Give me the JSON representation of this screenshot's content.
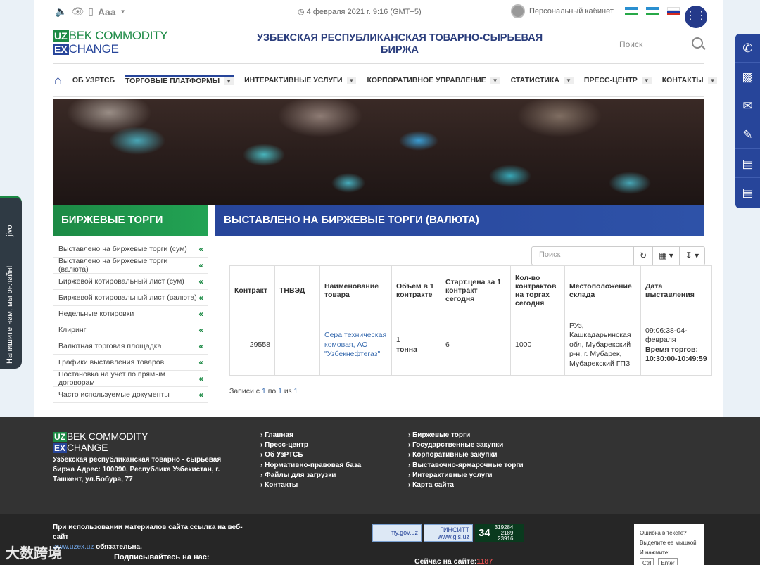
{
  "topbar": {
    "font_size_label": "Aaa",
    "datetime": "4 февраля 2021 г. 9:16 (GMT+5)",
    "cabinet_label": "Персональный кабинет"
  },
  "header": {
    "logo_box_1": "UZ",
    "logo_text_1": "BEK COMMODITY",
    "logo_box_2": "EX",
    "logo_text_2": "CHANGE",
    "title": "УЗБЕКСКАЯ РЕСПУБЛИКАНСКАЯ ТОВАРНО-СЫРЬЕВАЯ БИРЖА",
    "search_placeholder": "Поиск"
  },
  "nav": {
    "items": [
      {
        "label": "ОБ УЗРТСБ"
      },
      {
        "label": "ТОРГОВЫЕ ПЛАТФОРМЫ"
      },
      {
        "label": "ИНТЕРАКТИВНЫЕ УСЛУГИ"
      },
      {
        "label": "КОРПОРАТИВНОЕ УПРАВЛЕНИЕ"
      },
      {
        "label": "СТАТИСТИКА"
      },
      {
        "label": "ПРЕСС-ЦЕНТР"
      },
      {
        "label": "КОНТАКТЫ"
      }
    ]
  },
  "banner": {
    "left_title": "БИРЖЕВЫЕ ТОРГИ",
    "right_title": "ВЫСТАВЛЕНО НА БИРЖЕВЫЕ ТОРГИ (ВАЛЮТА)"
  },
  "sidebar": {
    "items": [
      {
        "label": "Выставлено на биржевые торги (сум)"
      },
      {
        "label": "Выставлено на биржевые торги (валюта)"
      },
      {
        "label": "Биржевой котировальный лист (сум)"
      },
      {
        "label": "Биржевой котировальный лист (валюта)"
      },
      {
        "label": "Недельные котировки"
      },
      {
        "label": "Клиринг"
      },
      {
        "label": "Валютная торговая площадка"
      },
      {
        "label": "Графики выставления товаров"
      },
      {
        "label": "Постановка на учет по прямым договорам"
      },
      {
        "label": "Часто используемые документы"
      }
    ]
  },
  "tools": {
    "search_placeholder": "Поиск"
  },
  "table": {
    "headers": [
      "Контракт",
      "ТНВЭД",
      "Наименование товара",
      "Объем в 1 контракте",
      "Старт.цена за 1 контракт сегодня",
      "Кол-во контрактов на торгах сегодня",
      "Местоположение склада",
      "Дата выставления"
    ],
    "row": {
      "contract": "29558",
      "tnved": "",
      "name": "Сера техническая комовая, АО \"Узбекнефтегаз\"",
      "volume_num": "1",
      "volume_unit": "тонна",
      "price": "6",
      "count": "1000",
      "location": "РУз, Кашкадарьинская обл, Мубарекский р-н, г. Мубарек, Мубарекский ГПЗ",
      "date": "09:06:38-04-февраля",
      "time_label": "Время торгов:",
      "time_value": "10:30:00-10:49:59"
    }
  },
  "records": {
    "prefix": "Записи с",
    "from": "1",
    "mid": "по",
    "to": "1",
    "mid2": "из",
    "total": "1"
  },
  "live_widget": {
    "label": "Напишите нам, мы онлайн!",
    "short": "jivo"
  },
  "footer": {
    "logo_box_1": "UZ",
    "logo_text_1": "BEK COMMODITY",
    "logo_box_2": "EX",
    "logo_text_2": "CHANGE",
    "address": "Узбекская республиканская товарно - сырьевая биржа Адрес: 100090, Республика Узбекистан, г. Ташкент, ул.Бобура, 77",
    "links_col1": [
      "Главная",
      "Пресс-центр",
      "Об УзРТСБ",
      "Нормативно-правовая база",
      "Файлы для загрузки",
      "Контакты"
    ],
    "links_col2": [
      "Биржевые торги",
      "Государственные закупки",
      "Корпоративные закупки",
      "Выставочно-ярмарочные торги",
      "Интерактивные услуги",
      "Карта сайта"
    ],
    "notice_text": "При использовании материалов сайта ссылка на веб-сайт",
    "notice_link": "www.uzex.uz",
    "notice_tail": "обязательна.",
    "subscribe": "Подписывайтесь на нас:",
    "badge_1": "my.gov.uz",
    "badge_2_top": "ГИНСИТТ",
    "badge_2_bottom": "www.gis.uz",
    "counter_main": "34",
    "counter_1": "319284",
    "counter_2": "2189",
    "counter_3": "23916",
    "online_label": "Сейчас на сайте:",
    "online_value": "1187",
    "error_line1": "Ошибка в тексте?",
    "error_line2": "Выделите ее мышкой",
    "error_line3": "И нажмите:",
    "error_key1": "Ctrl",
    "error_key2": "Enter"
  },
  "watermark": "大数跨境",
  "colors": {
    "brand_green": "#1c8a45",
    "brand_blue": "#27459a",
    "footer_bg": "#333333",
    "link_blue": "#3b6db0"
  }
}
